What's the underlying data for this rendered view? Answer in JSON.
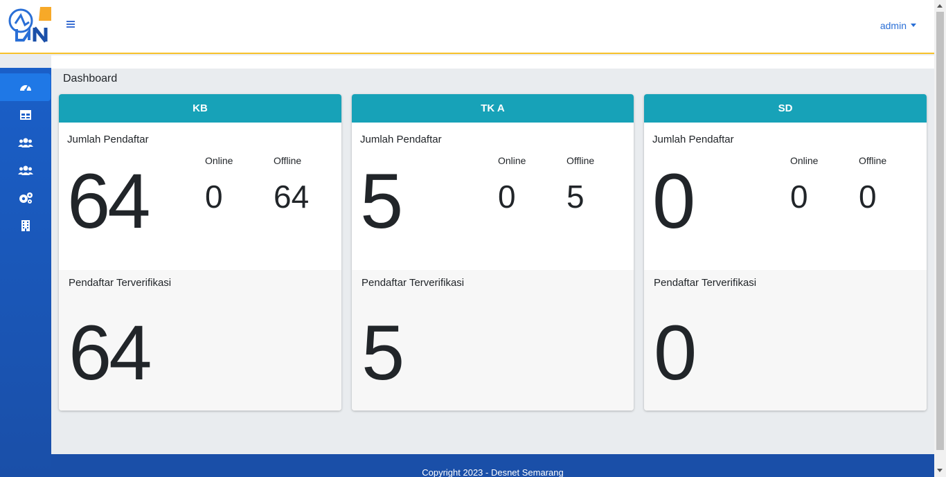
{
  "header": {
    "user": "admin"
  },
  "page": {
    "title": "Dashboard"
  },
  "sidebar": {
    "items": [
      {
        "icon": "tachometer-icon",
        "active": true
      },
      {
        "icon": "table-icon",
        "active": false
      },
      {
        "icon": "users-icon",
        "active": false
      },
      {
        "icon": "users-icon",
        "active": false
      },
      {
        "icon": "cogs-icon",
        "active": false
      },
      {
        "icon": "building-icon",
        "active": false
      }
    ]
  },
  "cards": [
    {
      "title": "KB",
      "registrants_label": "Jumlah Pendaftar",
      "total": "64",
      "online_label": "Online",
      "online": "0",
      "offline_label": "Offline",
      "offline": "64",
      "verified_label": "Pendaftar Terverifikasi",
      "verified": "64"
    },
    {
      "title": "TK A",
      "registrants_label": "Jumlah Pendaftar",
      "total": "5",
      "online_label": "Online",
      "online": "0",
      "offline_label": "Offline",
      "offline": "5",
      "verified_label": "Pendaftar Terverifikasi",
      "verified": "5"
    },
    {
      "title": "SD",
      "registrants_label": "Jumlah Pendaftar",
      "total": "0",
      "online_label": "Online",
      "online": "0",
      "offline_label": "Offline",
      "offline": "0",
      "verified_label": "Pendaftar Terverifikasi",
      "verified": "0"
    }
  ],
  "footer": {
    "text": "Copyright 2023 - Desnet Semarang"
  },
  "colors": {
    "sidebar": "#1a4fa8",
    "card_header": "#17a2b8",
    "accent_line": "#f7c12a",
    "link": "#2a6fd6"
  }
}
